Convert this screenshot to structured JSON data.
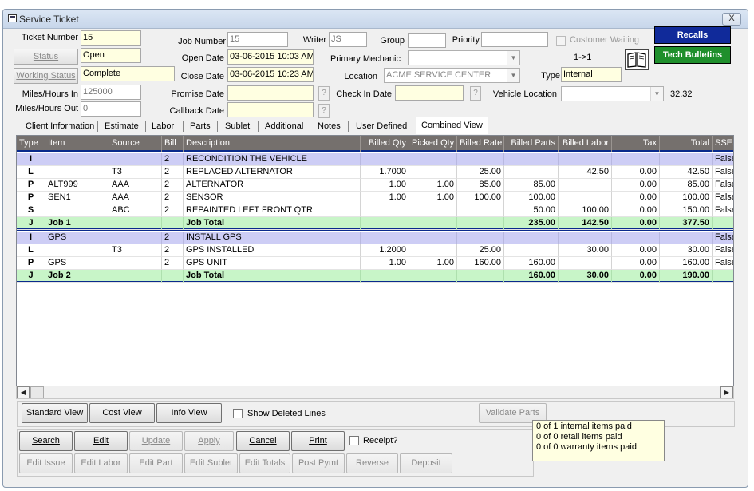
{
  "window": {
    "title": "Service Ticket",
    "close_label": "X"
  },
  "left_fields": {
    "ticket_number_label": "Ticket Number",
    "ticket_number": "15",
    "status_button": "Status",
    "status": "Open",
    "working_status_button": "Working Status",
    "working_status": "Complete",
    "miles_in_label": "Miles/Hours In",
    "miles_in": "125000",
    "miles_out_label": "Miles/Hours Out",
    "miles_out": "0"
  },
  "middle_fields": {
    "job_number_label": "Job Number",
    "job_number": "15",
    "writer_label": "Writer",
    "writer": "JS",
    "group_label": "Group",
    "group": "",
    "priority_label": "Priority",
    "priority": "",
    "open_date_label": "Open Date",
    "open_date": "03-06-2015 10:03 AM",
    "close_date_label": "Close Date",
    "close_date": "03-06-2015 10:23 AM",
    "promise_date_label": "Promise Date",
    "promise_date": "",
    "callback_date_label": "Callback Date",
    "callback_date": "",
    "primary_mechanic_label": "Primary Mechanic",
    "primary_mechanic": "",
    "location_label": "Location",
    "location": "ACME SERVICE CENTER",
    "check_in_date_label": "Check In Date",
    "check_in_date": "",
    "vehicle_location_label": "Vehicle Location",
    "vehicle_location": "",
    "vehicle_location_value": "32.32",
    "type_label": "Type",
    "type": "Internal",
    "customer_waiting_label": "Customer Waiting",
    "counter": "1->1",
    "question_mark": "?"
  },
  "side_buttons": {
    "recalls": "Recalls",
    "tech_bulletins": "Tech Bulletins"
  },
  "tabs": [
    "Client Information",
    "Estimate",
    "Labor",
    "Parts",
    "Sublet",
    "Additional",
    "Notes",
    "User Defined",
    "Combined View"
  ],
  "grid": {
    "headers": [
      "Type",
      "Item",
      "Source",
      "Bill",
      "Description",
      "Billed Qty",
      "Picked Qty",
      "Billed Rate",
      "Billed Parts",
      "Billed Labor",
      "Tax",
      "Total",
      "SSEx"
    ],
    "rows": [
      {
        "kind": "item",
        "cells": [
          "I",
          "",
          "",
          "2",
          "RECONDITION THE VEHICLE",
          "",
          "",
          "",
          "",
          "",
          "",
          "",
          "False"
        ]
      },
      {
        "kind": "line",
        "cells": [
          "L",
          "",
          "T3",
          "2",
          "REPLACED ALTERNATOR",
          "1.7000",
          "",
          "25.00",
          "",
          "42.50",
          "0.00",
          "42.50",
          "False"
        ]
      },
      {
        "kind": "line",
        "cells": [
          "P",
          "ALT999",
          "AAA",
          "2",
          "ALTERNATOR",
          "1.00",
          "1.00",
          "85.00",
          "85.00",
          "",
          "0.00",
          "85.00",
          "False"
        ]
      },
      {
        "kind": "line",
        "cells": [
          "P",
          "SEN1",
          "AAA",
          "2",
          "SENSOR",
          "1.00",
          "1.00",
          "100.00",
          "100.00",
          "",
          "0.00",
          "100.00",
          "False"
        ]
      },
      {
        "kind": "line",
        "cells": [
          "S",
          "",
          "ABC",
          "2",
          "REPAINTED LEFT FRONT QTR",
          "",
          "",
          "",
          "50.00",
          "100.00",
          "0.00",
          "150.00",
          "False"
        ]
      },
      {
        "kind": "job",
        "cells": [
          "J",
          "Job 1",
          "",
          "",
          "Job Total",
          "",
          "",
          "",
          "235.00",
          "142.50",
          "0.00",
          "377.50",
          ""
        ]
      },
      {
        "kind": "item",
        "cells": [
          "I",
          "GPS",
          "",
          "2",
          "INSTALL GPS",
          "",
          "",
          "",
          "",
          "",
          "",
          "",
          "False"
        ]
      },
      {
        "kind": "line",
        "cells": [
          "L",
          "",
          "T3",
          "2",
          "GPS INSTALLED",
          "1.2000",
          "",
          "25.00",
          "",
          "30.00",
          "0.00",
          "30.00",
          "False"
        ]
      },
      {
        "kind": "line",
        "cells": [
          "P",
          "GPS",
          "",
          "2",
          "GPS UNIT",
          "1.00",
          "1.00",
          "160.00",
          "160.00",
          "",
          "0.00",
          "160.00",
          "False"
        ]
      },
      {
        "kind": "job",
        "cells": [
          "J",
          "Job 2",
          "",
          "",
          "Job Total",
          "",
          "",
          "",
          "160.00",
          "30.00",
          "0.00",
          "190.00",
          ""
        ]
      }
    ]
  },
  "view_buttons": {
    "standard": "Standard View",
    "cost": "Cost View",
    "info": "Info View",
    "show_deleted": "Show Deleted Lines",
    "validate_parts": "Validate Parts"
  },
  "action_buttons": {
    "search": "Search",
    "edit": "Edit",
    "update": "Update",
    "apply": "Apply",
    "cancel": "Cancel",
    "print": "Print",
    "receipt": "Receipt?",
    "edit_issue": "Edit Issue",
    "edit_labor": "Edit Labor",
    "edit_part": "Edit Part",
    "edit_sublet": "Edit Sublet",
    "edit_totals": "Edit Totals",
    "post_pymt": "Post Pymt",
    "reverse": "Reverse",
    "deposit": "Deposit"
  },
  "payment_status": [
    "0 of 1 internal items paid",
    "0 of 0 retail items paid",
    "0 of 0 warranty items paid"
  ]
}
